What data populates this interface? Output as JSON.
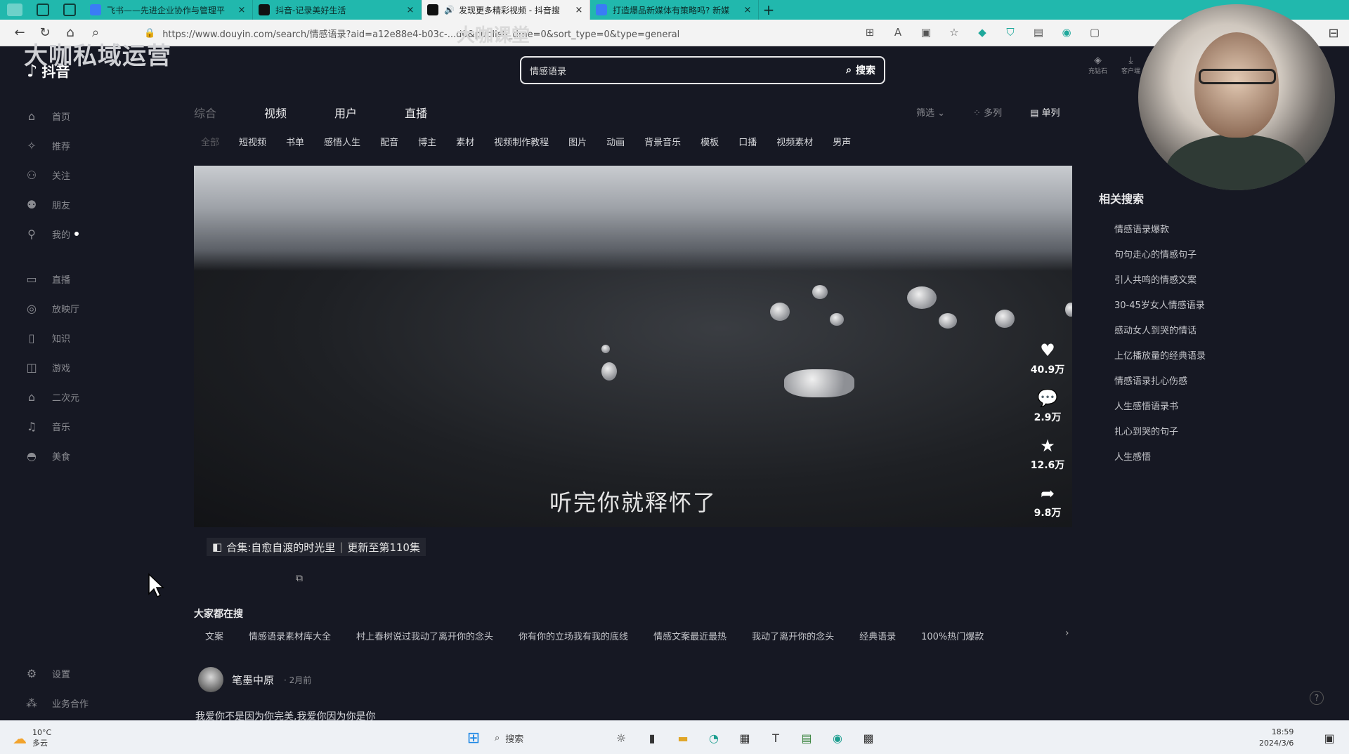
{
  "browser": {
    "tabs": [
      {
        "title": "飞书——先进企业协作与管理平",
        "active": false
      },
      {
        "title": "抖音-记录美好生活",
        "active": false
      },
      {
        "title": "发现更多精彩视频 - 抖音搜",
        "active": true
      },
      {
        "title": "打造爆品新媒体有策略吗? 新媒",
        "active": false
      }
    ],
    "url": "https://www.douyin.com/search/情感语录?aid=a12e88e4-b03c-...d0&publish_time=0&sort_type=0&type=general"
  },
  "watermark": {
    "left": "大咖私域运营",
    "right": "大咖课堂"
  },
  "logo": {
    "text": "抖音"
  },
  "sidebar": {
    "items": [
      {
        "label": "首页",
        "icon": "home-icon"
      },
      {
        "label": "推荐",
        "icon": "star-icon"
      },
      {
        "label": "关注",
        "icon": "follow-icon"
      },
      {
        "label": "朋友",
        "icon": "friends-icon"
      },
      {
        "label": "我的",
        "icon": "user-icon"
      }
    ],
    "items2": [
      {
        "label": "直播",
        "icon": "live-icon"
      },
      {
        "label": "放映厅",
        "icon": "cinema-icon"
      },
      {
        "label": "知识",
        "icon": "book-icon"
      },
      {
        "label": "游戏",
        "icon": "game-icon"
      },
      {
        "label": "二次元",
        "icon": "anime-icon"
      },
      {
        "label": "音乐",
        "icon": "music-icon"
      },
      {
        "label": "美食",
        "icon": "food-icon"
      }
    ],
    "bottom": [
      {
        "label": "设置",
        "icon": "settings-icon"
      },
      {
        "label": "业务合作",
        "icon": "business-icon"
      }
    ]
  },
  "search": {
    "value": "情感语录",
    "button": "搜索"
  },
  "topRight": {
    "a": "充钻石",
    "b": "客户端"
  },
  "mainTabs": [
    "综合",
    "视频",
    "用户",
    "直播"
  ],
  "filter": {
    "filter": "筛选",
    "multi": "多列",
    "single": "单列"
  },
  "subTabs": [
    "全部",
    "短视频",
    "书单",
    "感悟人生",
    "配音",
    "博主",
    "素材",
    "视频制作教程",
    "图片",
    "动画",
    "背景音乐",
    "模板",
    "口播",
    "视频素材",
    "男声"
  ],
  "video": {
    "subtitle": "听完你就释怀了",
    "likes": "40.9万",
    "comments": "2.9万",
    "favorites": "12.6万",
    "shares": "9.8万",
    "collection": {
      "prefix": "合集:",
      "name": "自愈自渡的时光里",
      "update": "更新至第110集"
    }
  },
  "hotSearch": {
    "title": "大家都在搜",
    "items": [
      "文案",
      "情感语录素材库大全",
      "村上春树说过我动了离开你的念头",
      "你有你的立场我有我的底线",
      "情感文案最近最热",
      "我动了离开你的念头",
      "经典语录",
      "100%热门爆款"
    ]
  },
  "author": {
    "name": "笔墨中原",
    "time": "2月前",
    "desc": "我爱你不是因为你完美,我爱你因为你是你"
  },
  "related": {
    "title": "相关搜索",
    "items": [
      "情感语录爆款",
      "句句走心的情感句子",
      "引人共鸣的情感文案",
      "30-45岁女人情感语录",
      "感动女人到哭的情话",
      "上亿播放量的经典语录",
      "情感语录扎心伤感",
      "人生感悟语录书",
      "扎心到哭的句子",
      "人生感悟"
    ]
  },
  "taskbar": {
    "temp": "10°C",
    "weather": "多云",
    "search": "搜索",
    "time": "18:59",
    "date": "2024/3/6"
  }
}
